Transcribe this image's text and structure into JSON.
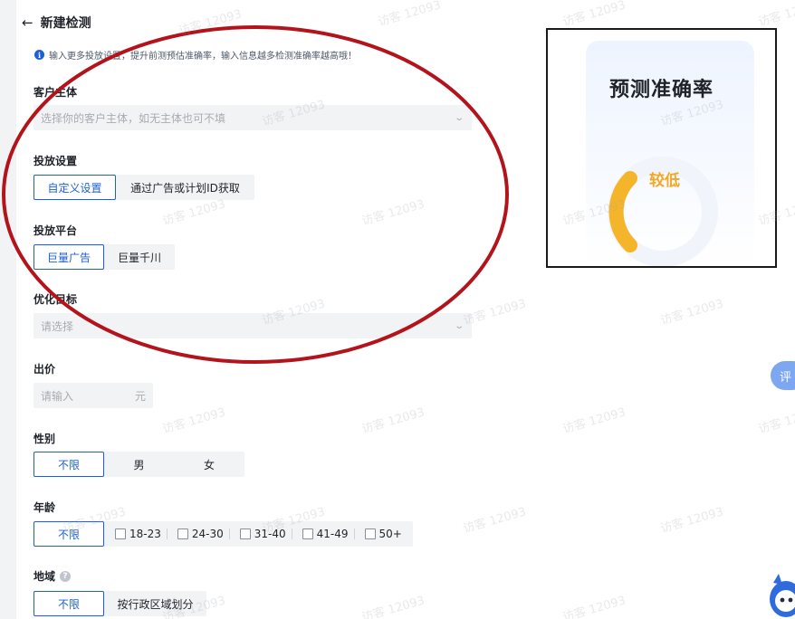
{
  "header": {
    "back_icon": "arrow-left-icon",
    "title": "新建检测"
  },
  "tip": {
    "icon": "info-icon",
    "text": "输入更多投放设置，提升前测预估准确率，输入信息越多检测准确率越高哦！"
  },
  "customer": {
    "label": "客户主体",
    "placeholder": "选择你的客户主体，如无主体也可不填"
  },
  "delivery_setting": {
    "label": "投放设置",
    "options": [
      "自定义设置",
      "通过广告或计划ID获取"
    ],
    "selected": "自定义设置"
  },
  "platform": {
    "label": "投放平台",
    "options": [
      "巨量广告",
      "巨量千川"
    ],
    "selected": "巨量广告"
  },
  "optimize_goal": {
    "label": "优化目标",
    "placeholder": "请选择"
  },
  "bid": {
    "label": "出价",
    "placeholder": "请输入",
    "unit": "元"
  },
  "gender": {
    "label": "性别",
    "options": [
      "不限",
      "男",
      "女"
    ],
    "selected": "不限"
  },
  "age": {
    "label": "年龄",
    "all_label": "不限",
    "options": [
      "18-23",
      "24-30",
      "31-40",
      "41-49",
      "50+"
    ]
  },
  "region": {
    "label": "地域",
    "options": [
      "不限",
      "按行政区域划分"
    ],
    "selected": "不限",
    "help_icon": "question-icon"
  },
  "preview": {
    "title": "预测准确率",
    "level": "较低"
  },
  "float_button": {
    "label": "评"
  },
  "watermark": {
    "text": "访客 12093"
  },
  "colors": {
    "accent": "#1d5fd6",
    "warning": "#f5a623",
    "annotation": "#b3141c"
  }
}
